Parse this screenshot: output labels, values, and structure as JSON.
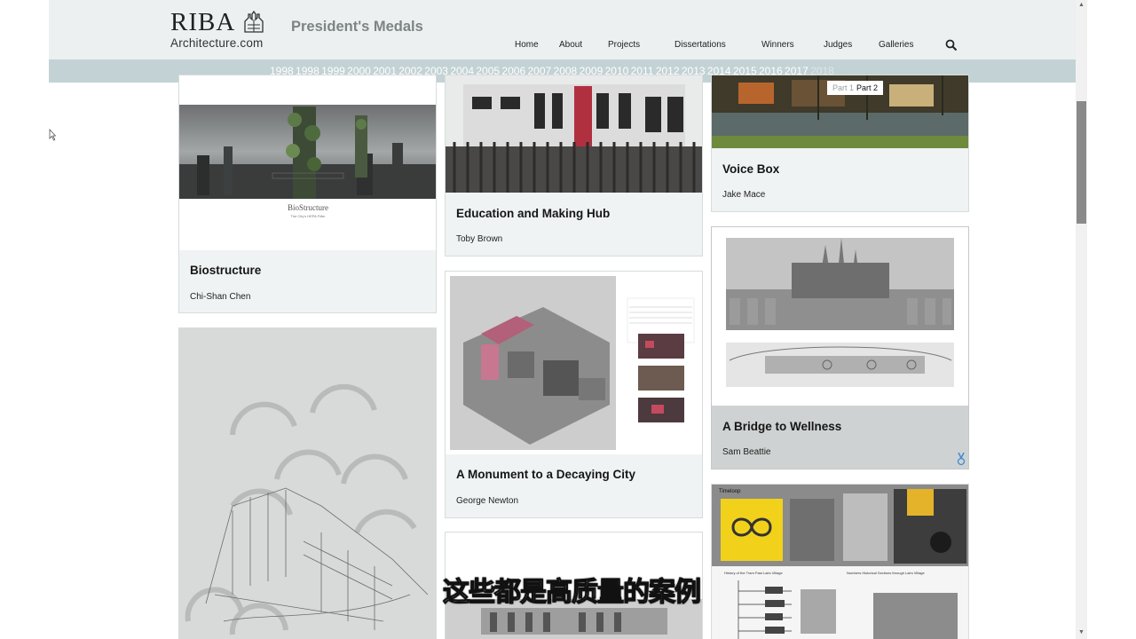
{
  "header": {
    "logo_riba": "RIBA",
    "logo_domain": "Architecture.com",
    "site_title": "President's Medals",
    "nav": [
      "Home",
      "About",
      "Projects",
      "Dissertations",
      "Winners",
      "Judges",
      "Galleries"
    ],
    "search_icon": "search-icon"
  },
  "year_bar": {
    "years": [
      "1998",
      "1998",
      "1999",
      "2000",
      "2001",
      "2002",
      "2003",
      "2004",
      "2005",
      "2006",
      "2007",
      "2008",
      "2009",
      "2010",
      "2011",
      "2012",
      "2013",
      "2014",
      "2015",
      "2016",
      "2017"
    ],
    "selected_year": "2018",
    "tooltip": {
      "part1": "Part 1",
      "part2": "Part 2"
    }
  },
  "cards": [
    {
      "title": "Biostructure",
      "author": "Chi-Shan Chen",
      "poster_title": "BioStructure",
      "poster_sub": "The City's HEPA Filter"
    },
    {
      "title": "Education and Making Hub",
      "author": "Toby Brown"
    },
    {
      "title": "Voice Box",
      "author": "Jake Mace"
    },
    {
      "title": "A Monument to a Decaying City",
      "author": "George Newton"
    },
    {
      "title": "A Bridge to Wellness",
      "author": "Sam Beattie",
      "medal_icon": "medal-icon"
    },
    {
      "title": "",
      "author": "",
      "poster_heading": "Timeloop",
      "poster_sub1": "History of the Tram Past Lairs Village",
      "poster_sub2": "Numbers Historical Sections through Lairs Village"
    }
  ],
  "subtitle": "这些都是高质量的案例",
  "colors": {
    "header_bg": "#ecf0f0",
    "year_bar_bg": "#c3d2d5",
    "card_bg": "#f0f3f3",
    "title_gray": "#7d8484"
  }
}
